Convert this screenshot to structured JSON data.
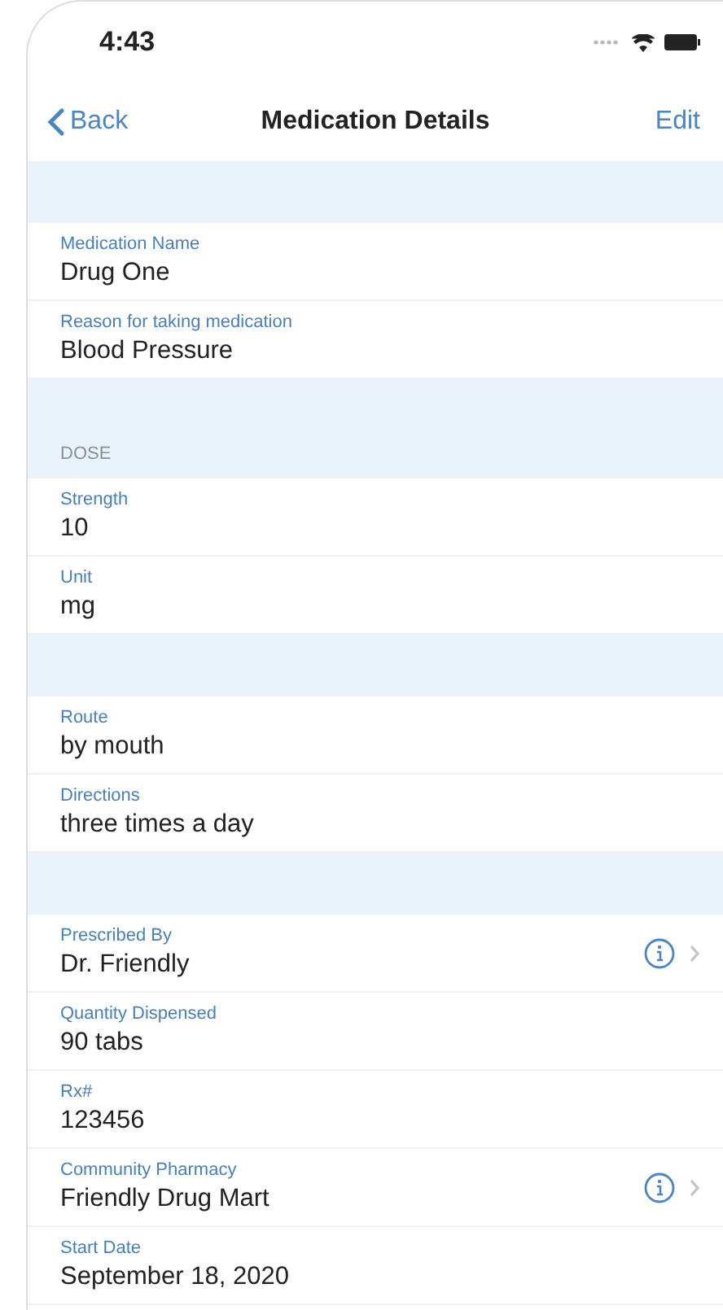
{
  "status_bar": {
    "time": "4:43"
  },
  "nav_bar": {
    "back": "Back",
    "title": "Medication Details",
    "action": "Edit"
  },
  "sections": [
    {
      "rows": [
        {
          "label": "Medication Name",
          "value": "Drug One",
          "has_detail": false
        },
        {
          "label": "Reason for taking medication",
          "value": "Blood Pressure",
          "has_detail": false
        }
      ]
    },
    {
      "header": "DOSE",
      "rows": [
        {
          "label": "Strength",
          "value": "10",
          "has_detail": false
        },
        {
          "label": "Unit",
          "value": "mg",
          "has_detail": false
        }
      ]
    },
    {
      "rows": [
        {
          "label": "Route",
          "value": "by mouth",
          "has_detail": false
        },
        {
          "label": "Directions",
          "value": "three times a day",
          "has_detail": false
        }
      ]
    },
    {
      "rows": [
        {
          "label": "Prescribed By",
          "value": "Dr. Friendly",
          "has_detail": true
        },
        {
          "label": "Quantity Dispensed",
          "value": "90 tabs",
          "has_detail": false
        },
        {
          "label": "Rx#",
          "value": "123456",
          "has_detail": false
        },
        {
          "label": "Community Pharmacy",
          "value": "Friendly Drug Mart",
          "has_detail": true
        },
        {
          "label": "Start Date",
          "value": "September 18, 2020",
          "has_detail": false
        }
      ]
    }
  ]
}
